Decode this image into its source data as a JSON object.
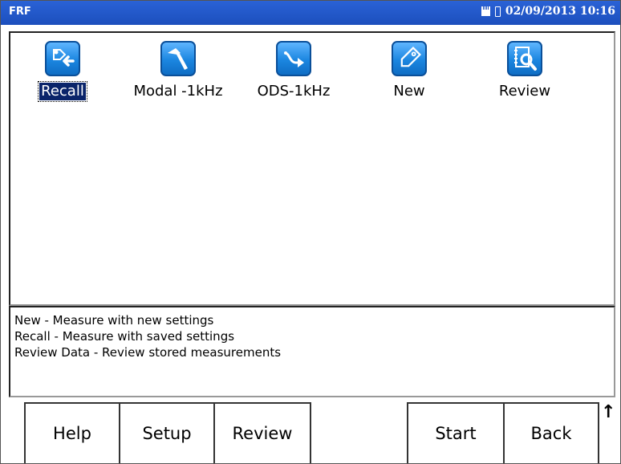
{
  "titlebar": {
    "title": "FRF",
    "datetime": "02/09/2013 10:16"
  },
  "apps": [
    {
      "label": "Recall",
      "icon": "recall-icon",
      "selected": true
    },
    {
      "label": "Modal -1kHz",
      "icon": "hammer-icon",
      "selected": false
    },
    {
      "label": "ODS-1kHz",
      "icon": "ods-arrow-icon",
      "selected": false
    },
    {
      "label": "New",
      "icon": "tag-icon",
      "selected": false
    },
    {
      "label": "Review",
      "icon": "review-magnifier-icon",
      "selected": false
    }
  ],
  "info": [
    "New - Measure with new settings",
    "Recall - Measure with saved settings",
    "Review Data - Review stored measurements"
  ],
  "softkeys": {
    "help": "Help",
    "setup": "Setup",
    "review": "Review",
    "start": "Start",
    "back": "Back"
  },
  "scroll_indicator": "↑",
  "colors": {
    "titlebar": "#1c4fbd",
    "icon_blue": "#1b86e0",
    "selection": "#0a246a"
  }
}
